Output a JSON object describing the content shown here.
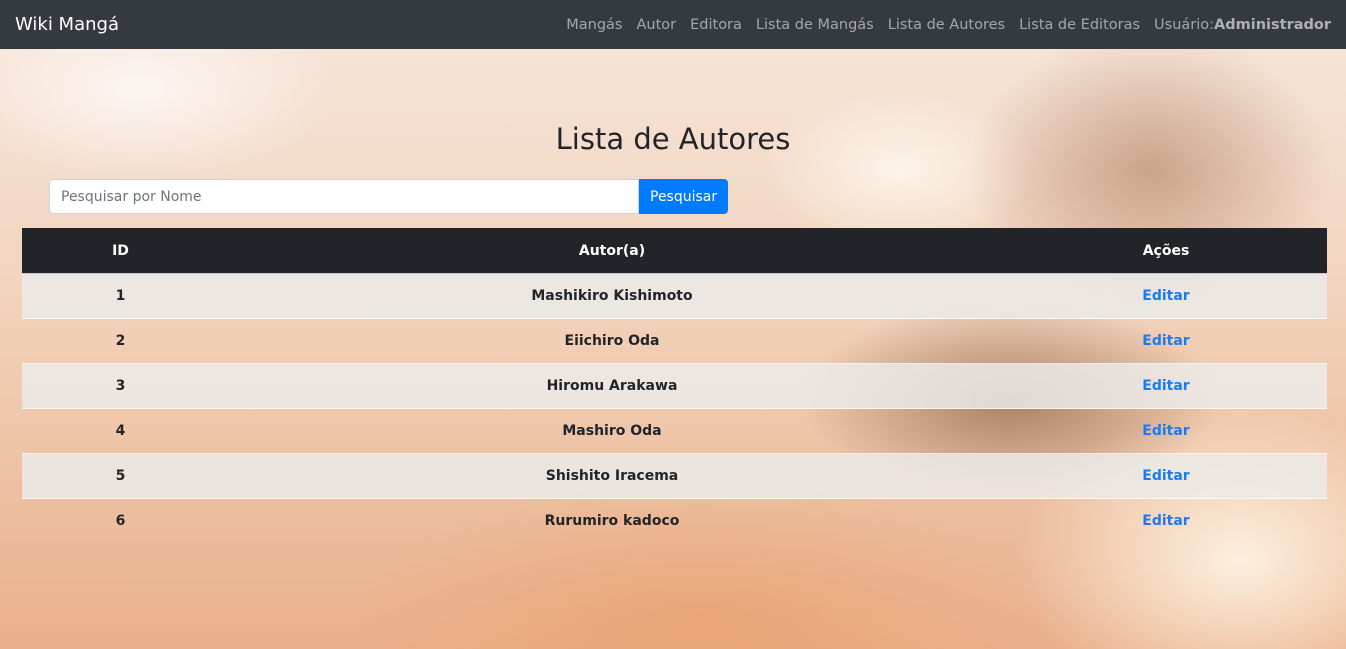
{
  "navbar": {
    "brand": "Wiki Mangá",
    "links": [
      "Mangás",
      "Autor",
      "Editora",
      "Lista de Mangás",
      "Lista de Autores",
      "Lista de Editoras"
    ],
    "user_label": "Usuário:",
    "user_name": "Administrador"
  },
  "page": {
    "title": "Lista de Autores"
  },
  "search": {
    "placeholder": "Pesquisar por Nome",
    "value": "",
    "button_label": "Pesquisar"
  },
  "table": {
    "headers": {
      "id": "ID",
      "author": "Autor(a)",
      "actions": "Ações"
    },
    "rows": [
      {
        "id": "1",
        "name": "Mashikiro Kishimoto",
        "action": "Editar"
      },
      {
        "id": "2",
        "name": "Eiichiro Oda",
        "action": "Editar"
      },
      {
        "id": "3",
        "name": "Hiromu Arakawa",
        "action": "Editar"
      },
      {
        "id": "4",
        "name": "Mashiro Oda",
        "action": "Editar"
      },
      {
        "id": "5",
        "name": "Shishito Iracema",
        "action": "Editar"
      },
      {
        "id": "6",
        "name": "Rurumiro kadoco",
        "action": "Editar"
      }
    ]
  },
  "colors": {
    "navbar": "#343a40",
    "table_header": "#212529",
    "primary": "#007bff",
    "link": "#1a7cf2"
  }
}
